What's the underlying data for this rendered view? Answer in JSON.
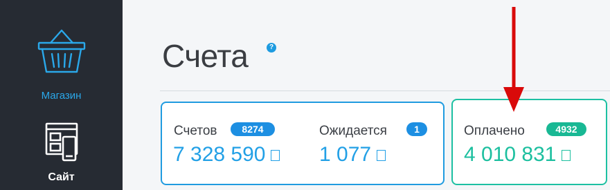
{
  "sidebar": {
    "items": [
      {
        "label": "Магазин",
        "icon": "shopping-basket-icon",
        "active": true
      },
      {
        "label": "Сайт",
        "icon": "site-layout-icon",
        "active": false
      }
    ]
  },
  "page": {
    "title": "Счета",
    "help": "?"
  },
  "stats": {
    "invoices": {
      "label": "Счетов",
      "count": "8274",
      "amount": "7 328 590"
    },
    "expected": {
      "label": "Ожидается",
      "count": "1",
      "amount": "1 077"
    },
    "paid": {
      "label": "Оплачено",
      "count": "4932",
      "amount": "4 010 831"
    }
  },
  "colors": {
    "sidebar": "#262b33",
    "accent_blue": "#1f9be0",
    "accent_green": "#1cc0a2",
    "arrow": "#d90a0a"
  }
}
